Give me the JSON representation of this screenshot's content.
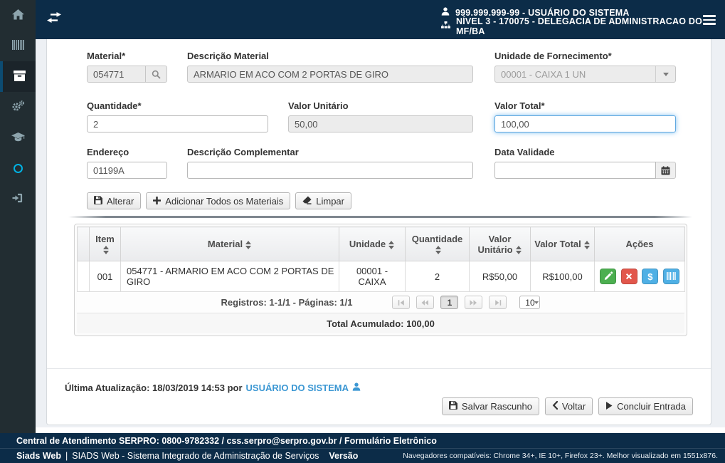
{
  "header": {
    "user": "999.999.999-99 - USUÁRIO DO SISTEMA",
    "org": "NÍVEL 3 - 170075 - DELEGACIA DE ADMINISTRACAO DO MF/BA"
  },
  "sidebar": {
    "items": [
      "home",
      "barcode",
      "warehouse",
      "settings",
      "education",
      "status-circle",
      "logout"
    ],
    "active_item": "warehouse"
  },
  "form": {
    "material": {
      "label": "Material*",
      "value": "054771"
    },
    "descricao_material": {
      "label": "Descrição Material",
      "value": "ARMARIO EM ACO COM 2 PORTAS DE GIRO"
    },
    "unidade_fornecimento": {
      "label": "Unidade de Fornecimento*",
      "value": "00001 - CAIXA 1 UN"
    },
    "quantidade": {
      "label": "Quantidade*",
      "value": "2"
    },
    "valor_unitario": {
      "label": "Valor Unitário",
      "value": "50,00"
    },
    "valor_total": {
      "label": "Valor Total*",
      "value": "100,00"
    },
    "endereco": {
      "label": "Endereço",
      "value": "01199A"
    },
    "descricao_complementar": {
      "label": "Descrição Complementar",
      "value": ""
    },
    "data_validade": {
      "label": "Data Validade",
      "value": ""
    },
    "buttons": {
      "alterar": "Alterar",
      "adicionar_todos": "Adicionar Todos os Materiais",
      "limpar": "Limpar"
    }
  },
  "table": {
    "headers": {
      "item": "Item",
      "material": "Material",
      "unidade": "Unidade",
      "quantidade": "Quantidade",
      "valor_unitario": "Valor Unitário",
      "valor_total": "Valor Total",
      "acoes": "Ações"
    },
    "row": {
      "item": "001",
      "material": "054771 - ARMARIO EM ACO COM 2 PORTAS DE GIRO",
      "unidade": "00001 - CAIXA",
      "quantidade": "2",
      "valor_unitario": "R$50,00",
      "valor_total": "R$100,00"
    },
    "paginator": {
      "summary": "Registros: 1-1/1 - Páginas: 1/1",
      "page": "1",
      "rows_per_page": "10"
    },
    "total": "Total Acumulado: 100,00"
  },
  "status": {
    "last_update": "Última Atualização: 18/03/2019 14:53 por",
    "user_link": "USUÁRIO DO SISTEMA"
  },
  "actions": {
    "salvar_rascunho": "Salvar Rascunho",
    "voltar": "Voltar",
    "concluir": "Concluir Entrada"
  },
  "footer": {
    "support": "Central de Atendimento SERPRO: 0800-9782332 / css.serpro@serpro.gov.br / Formulário Eletrônico",
    "brand": "Siads Web",
    "separator": "|",
    "system": "SIADS Web - Sistema Integrado de Administração de Serviços",
    "version_label": "Versão",
    "compat": "Navegadores compatíveis: Chrome 34+, IE 10+, Firefox 23+. Melhor visualizado em 1551x876."
  },
  "icons": {
    "row_actions": [
      "edit-pencil",
      "delete-x",
      "money-dollar",
      "barcode"
    ],
    "colors": {
      "header_navy": "#0c2c48",
      "sidebar_dark": "#222d32",
      "link_blue": "#3b97d3",
      "success_green": "#4caf50",
      "danger_red": "#e2574c",
      "info_blue": "#4fb0e5",
      "circle_cyan": "#00b2e3"
    }
  }
}
